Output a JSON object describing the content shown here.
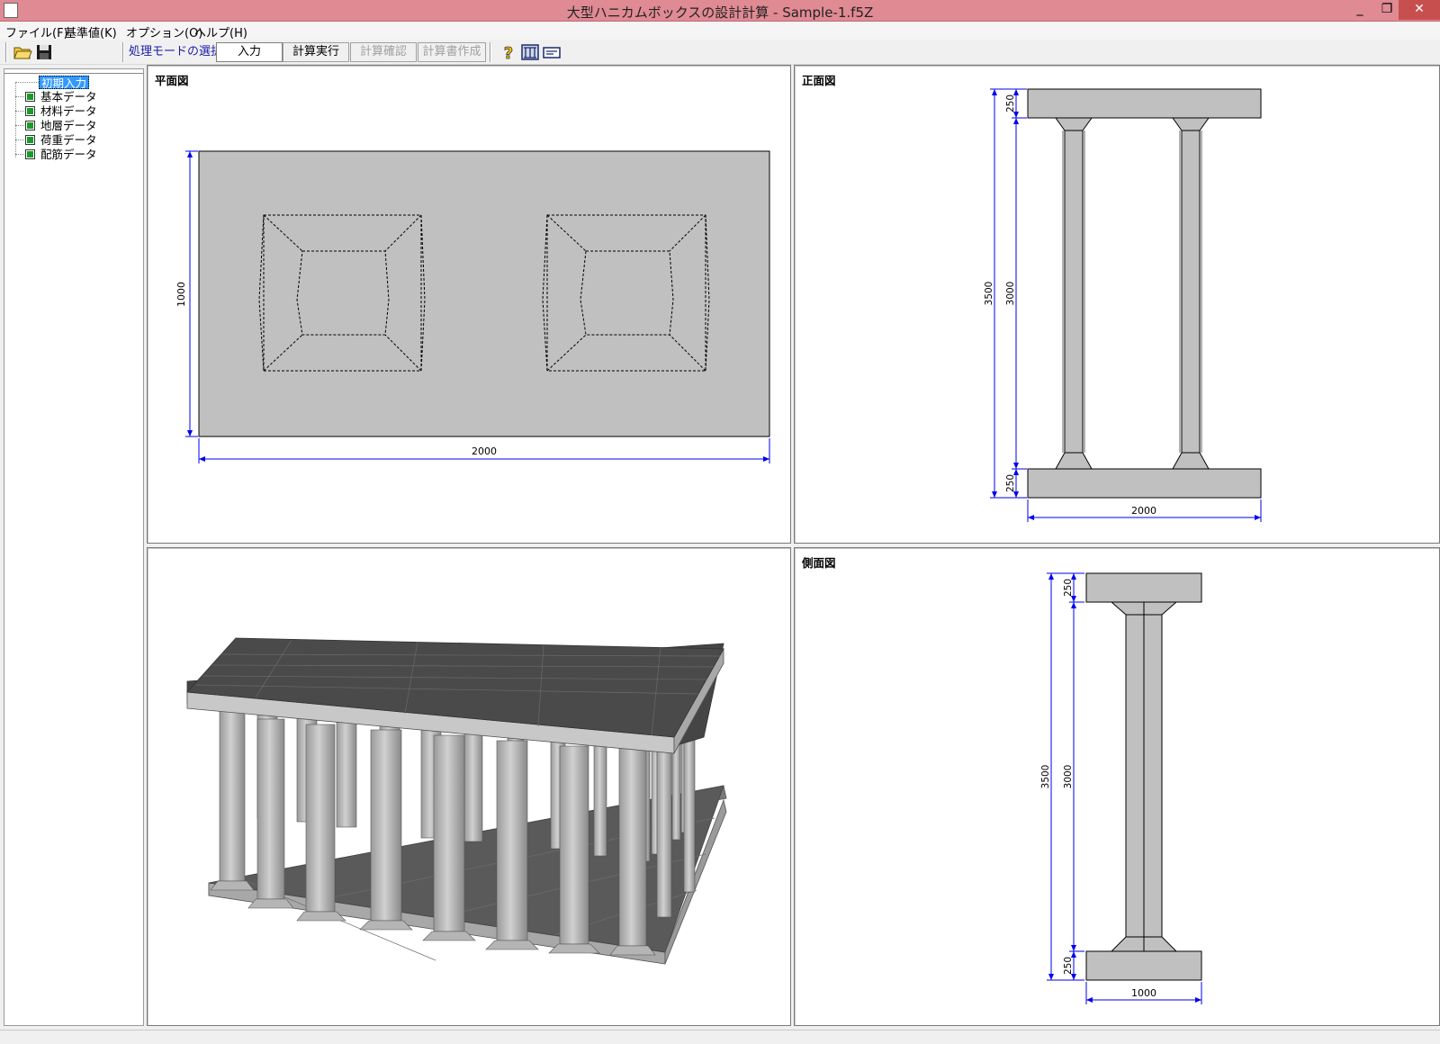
{
  "window": {
    "title": "大型ハニカムボックスの設計計算 - Sample-1.f5Z",
    "minimize": "_",
    "restore": "❐",
    "close": "✕"
  },
  "menu": [
    "ファイル(F)",
    "基準値(K)",
    "オプション(O)",
    "ヘルプ(H)"
  ],
  "toolbar": {
    "mode_label": "処理モードの選択",
    "buttons": [
      "入力",
      "計算実行",
      "計算確認",
      "計算書作成"
    ],
    "icons": [
      "open-folder-icon",
      "save-disk-icon",
      "help-icon",
      "model-view-icon",
      "card-icon"
    ]
  },
  "tree": {
    "root": "初期入力",
    "items": [
      "基本データ",
      "材料データ",
      "地層データ",
      "荷重データ",
      "配筋データ"
    ]
  },
  "views": {
    "plan": {
      "label": "平面図",
      "width": "2000",
      "height": "1000"
    },
    "front": {
      "label": "正面図",
      "top_slab": "250",
      "column": "3000",
      "bottom_slab": "250",
      "total": "3500",
      "width": "2000"
    },
    "side": {
      "label": "側面図",
      "top_slab": "250",
      "column": "3000",
      "bottom_slab": "250",
      "total": "3500",
      "width": "1000"
    }
  }
}
